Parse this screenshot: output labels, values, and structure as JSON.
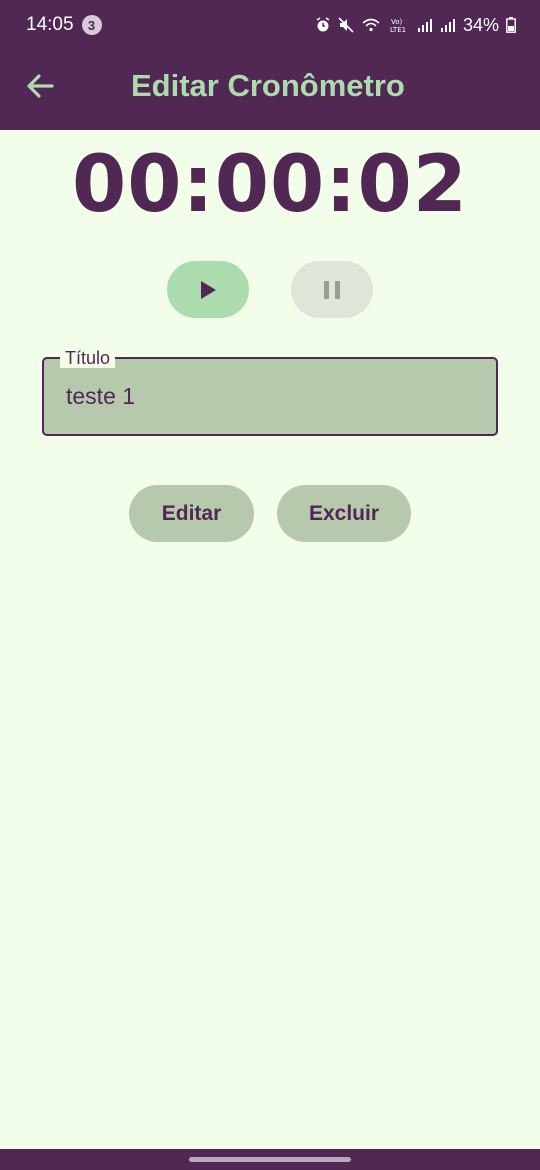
{
  "status": {
    "time": "14:05",
    "notification_count": "3",
    "battery": "34%",
    "icons": [
      "alarm-icon",
      "mute-icon",
      "wifi-icon",
      "volte-icon",
      "signal-icon",
      "signal-icon",
      "battery-icon"
    ]
  },
  "appbar": {
    "title": "Editar Cronômetro",
    "back_icon": "arrow-left-icon"
  },
  "timer": {
    "display": "00:00:02"
  },
  "controls": {
    "play_icon": "play-icon",
    "pause_icon": "pause-icon"
  },
  "form": {
    "title_label": "Título",
    "title_value": "teste 1"
  },
  "actions": {
    "edit_label": "Editar",
    "delete_label": "Excluir"
  },
  "colors": {
    "primary": "#512853",
    "accent": "#acdcae",
    "background": "#f2fdea",
    "field": "#b7c9ad"
  }
}
